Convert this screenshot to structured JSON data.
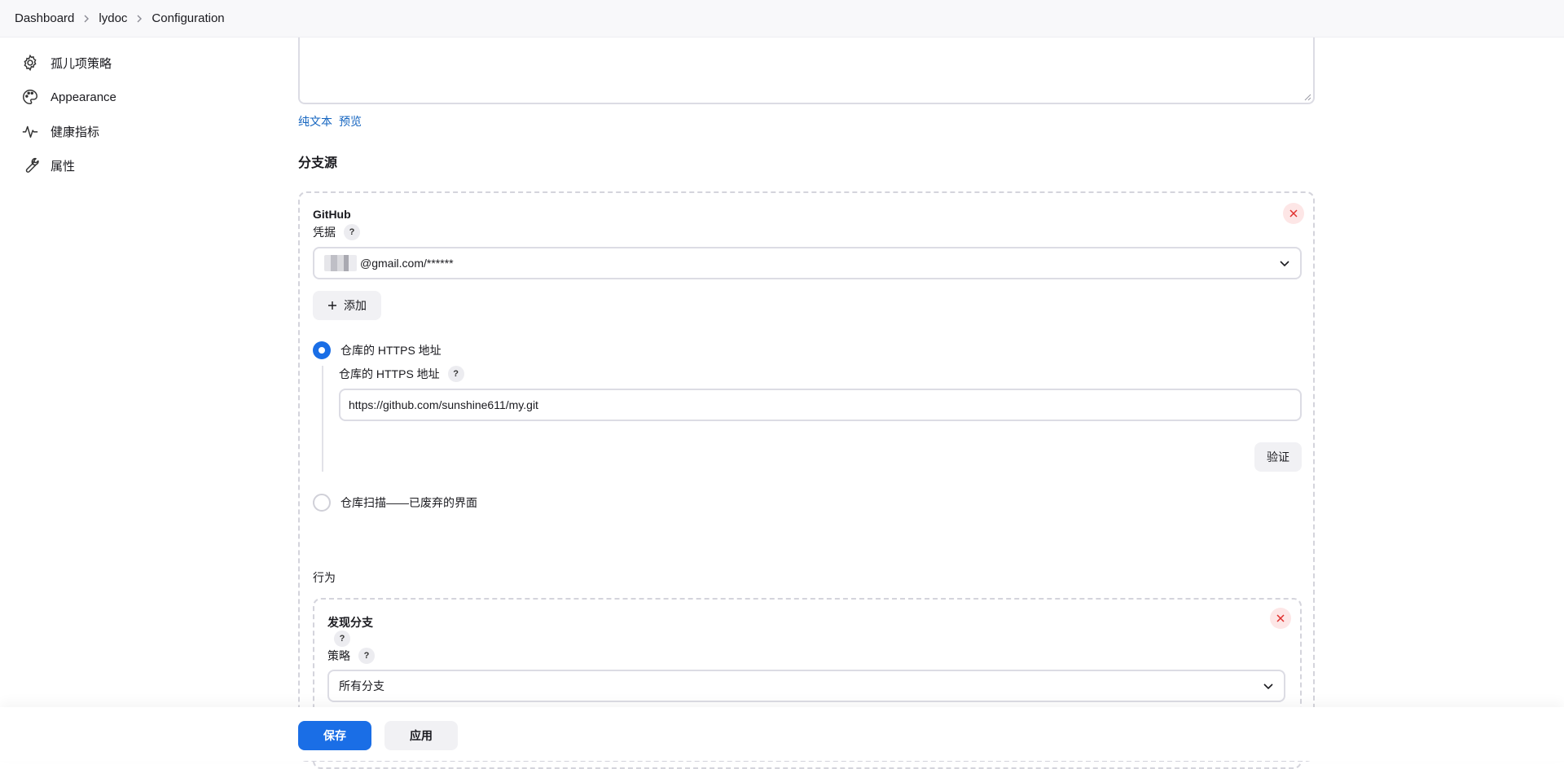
{
  "breadcrumb": {
    "items": [
      "Dashboard",
      "lydoc",
      "Configuration"
    ]
  },
  "sidebar": {
    "items": [
      {
        "label": "孤儿项策略",
        "icon": "gear-icon"
      },
      {
        "label": "Appearance",
        "icon": "palette-icon"
      },
      {
        "label": "健康指标",
        "icon": "pulse-icon"
      },
      {
        "label": "属性",
        "icon": "wrench-icon"
      }
    ]
  },
  "description": {
    "links": [
      "纯文本",
      "预览"
    ]
  },
  "branch_sources": {
    "title": "分支源",
    "github": {
      "title": "GitHub",
      "credentials_label": "凭据",
      "credentials_value": "@gmail.com/******",
      "add_label": "添加",
      "radio_https_label": "仓库的 HTTPS 地址",
      "https_field_label": "仓库的 HTTPS 地址",
      "https_value": "https://github.com/sunshine611/my.git",
      "validate_label": "验证",
      "radio_scan_label": "仓库扫描——已废弃的界面",
      "behaviors_label": "行为",
      "discover": {
        "title": "发现分支",
        "strategy_label": "策略",
        "strategy_value": "所有分支"
      }
    }
  },
  "help_glyph": "?",
  "actions": {
    "save": "保存",
    "apply": "应用"
  },
  "colors": {
    "primary": "#1a6ee6",
    "link": "#1565c0",
    "danger": "#e0302e"
  }
}
